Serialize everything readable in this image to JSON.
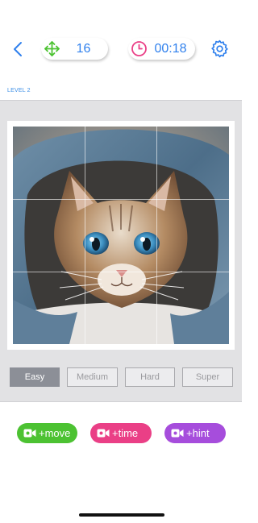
{
  "header": {
    "moves": "16",
    "timer": "00:18",
    "level_label": "LEVEL 2"
  },
  "icons": {
    "back": "chevron-left-icon",
    "moves": "move-arrows-icon",
    "timer": "clock-icon",
    "settings": "gear-icon",
    "reward": "video-camera-icon"
  },
  "board": {
    "grid": "3x3",
    "image": "kitten in denim hood"
  },
  "difficulty": {
    "options": [
      "Easy",
      "Medium",
      "Hard",
      "Super"
    ],
    "selected": "Easy"
  },
  "rewards": {
    "move_label": "+move",
    "time_label": "+time",
    "hint_label": "+hint"
  },
  "colors": {
    "accent_blue": "#2f80ed",
    "moves_green": "#4cc232",
    "time_pink": "#ea3f86",
    "hint_purple": "#a64ddc",
    "selected_difficulty": "#8c8f97"
  }
}
